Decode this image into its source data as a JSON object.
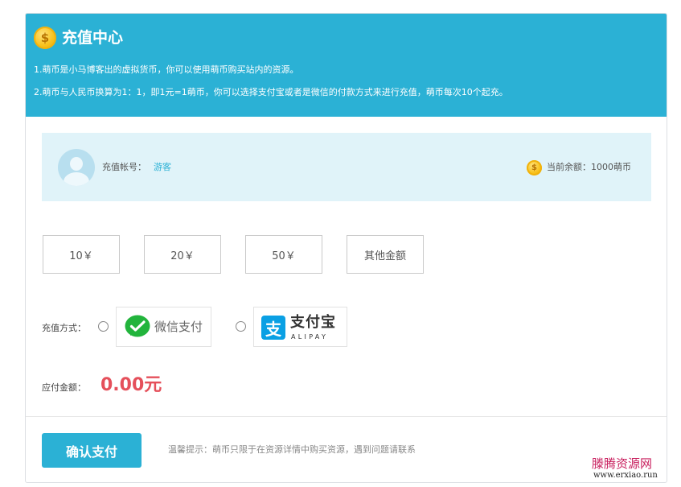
{
  "header": {
    "title": "充值中心",
    "coin_symbol": "$",
    "notes": [
      "1.萌币是小马博客出的虚拟货币，你可以使用萌币购买站内的资源。",
      "2.萌币与人民币换算为1：1，即1元=1萌币，你可以选择支付宝或者是微信的付款方式来进行充值，萌币每次10个起充。"
    ],
    "bg_color": "#2bb1d5"
  },
  "account": {
    "label": "充值帐号：",
    "username": "游客",
    "balance_text": "当前余额：1000萌币",
    "coin_symbol": "$"
  },
  "amounts": [
    "10￥",
    "20￥",
    "50￥",
    "其他金额"
  ],
  "payment": {
    "label": "充值方式：",
    "wechat_label": "微信支付",
    "alipay_label": "支付宝",
    "alipay_en": "ALIPAY",
    "alipay_glyph": "支"
  },
  "due": {
    "label": "应付金额：",
    "amount": "0.00元",
    "color": "#e5505b"
  },
  "footer": {
    "confirm_label": "确认支付",
    "tip": "温馨提示：萌币只限于在资源详情中购买资源，遇到问题请联系"
  },
  "watermark": {
    "cn": "滕腾资源网",
    "en": "www.erxiao.run"
  }
}
